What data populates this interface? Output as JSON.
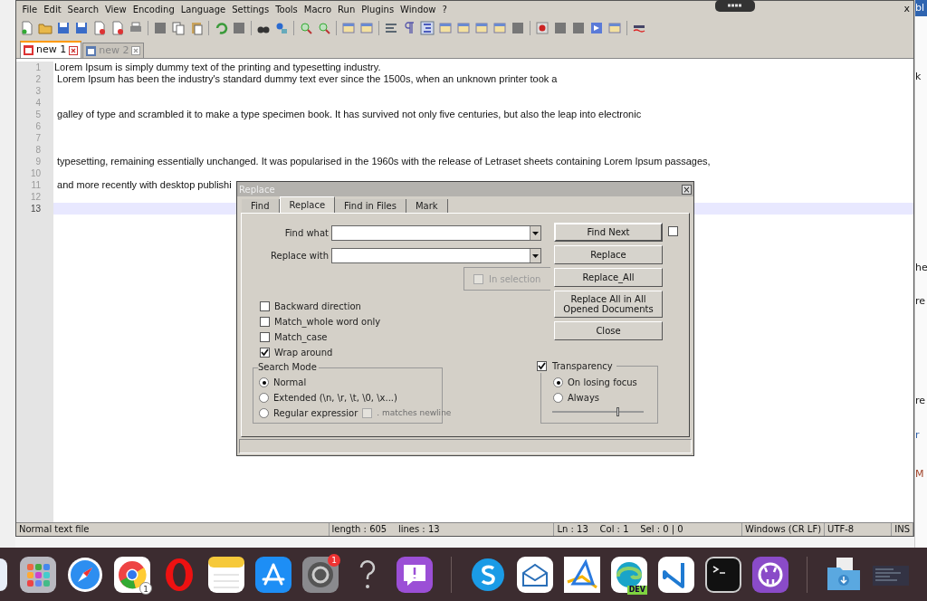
{
  "menu": [
    "File",
    "Edit",
    "Search",
    "View",
    "Encoding",
    "Language",
    "Settings",
    "Tools",
    "Macro",
    "Run",
    "Plugins",
    "Window",
    "?"
  ],
  "window_close": "x",
  "tabs": [
    {
      "label": "new 1",
      "selected": true
    },
    {
      "label": "new 2",
      "selected": false
    }
  ],
  "editor": {
    "lines": [
      {
        "number": "1",
        "text": "Lorem Ipsum is simply dummy text of the printing and typesetting industry.",
        "current": false
      },
      {
        "number": "2",
        "text": " Lorem Ipsum has been the industry's standard dummy text ever since the 1500s, when an unknown printer took a",
        "current": false
      },
      {
        "number": "3",
        "current": false
      },
      {
        "number": "4",
        "current": false
      },
      {
        "number": "5",
        "text": " galley of type and scrambled it to make a type specimen book. It has survived not only five centuries, but also the leap into electronic",
        "current": false
      },
      {
        "number": "6",
        "current": false
      },
      {
        "number": "7",
        "current": false
      },
      {
        "number": "8",
        "current": false
      },
      {
        "number": "9",
        "text": " typesetting, remaining essentially unchanged. It was popularised in the 1960s with the release of Letraset sheets containing Lorem Ipsum passages,",
        "current": false
      },
      {
        "number": "10",
        "current": false
      },
      {
        "number": "11",
        "text": " and more recently with desktop publishi",
        "current": false
      },
      {
        "number": "12",
        "current": false
      },
      {
        "number": "13",
        "current": true
      }
    ]
  },
  "status_bar": [
    "Normal text file",
    "length : 605    lines : 13",
    "Ln : 13    Col : 1    Sel : 0 | 0",
    "Windows (CR LF)",
    "UTF-8",
    "INS"
  ],
  "dialog": {
    "title": "Replace",
    "close": "×",
    "tabs": [
      {
        "label": "Find",
        "selected": false
      },
      {
        "label": "Replace",
        "selected": true
      },
      {
        "label": "Find in Files",
        "selected": false
      },
      {
        "label": "Mark",
        "selected": false
      }
    ],
    "find_what": {
      "label": "Find what"
    },
    "replace_with": {
      "label": "Replace with"
    },
    "find_next_checkbox": {
      "checked": false
    },
    "in_selection": {
      "label": "In selection",
      "checked": false,
      "disabled": true
    },
    "buttons": [
      "Find Next",
      "Replace",
      "Replace_All",
      "Replace All in All\nOpened Documents",
      "Close"
    ],
    "options": [
      {
        "label": "Backward direction",
        "checked": false
      },
      {
        "label": "Match_whole word only",
        "checked": false
      },
      {
        "label": "Match_case",
        "checked": false
      },
      {
        "label": "Wrap around",
        "checked": true
      }
    ],
    "search_mode": {
      "title": "Search Mode",
      "modes": [
        {
          "label": "Normal",
          "selected": true
        },
        {
          "label": "Extended (\\n, \\r, \\t, \\0, \\x...)",
          "selected": false
        },
        {
          "label": "Regular expressior",
          "selected": false
        }
      ],
      "matches_newline": {
        "label": ". matches newline",
        "checked": false,
        "disabled": true
      }
    },
    "transparency": {
      "label": "Transparency",
      "checked": true,
      "modes": [
        {
          "label": "On losing focus",
          "selected": true
        },
        {
          "label": "Always",
          "selected": false
        }
      ],
      "level": 0.72
    }
  },
  "background_page": [
    {
      "text": "bl",
      "kind": "header"
    },
    {
      "text": "k",
      "kind": "text"
    },
    {
      "text": "he",
      "kind": "text"
    },
    {
      "text": "re",
      "kind": "text"
    },
    {
      "text": "re",
      "kind": "text"
    },
    {
      "text": "r",
      "kind": "link"
    },
    {
      "text": "M",
      "kind": "warning"
    }
  ],
  "dock": [
    {
      "kind": "finder"
    },
    {
      "kind": "launchpad"
    },
    {
      "kind": "safari"
    },
    {
      "kind": "chrome",
      "badge": "1"
    },
    {
      "kind": "opera"
    },
    {
      "kind": "notes"
    },
    {
      "kind": "appstore"
    },
    {
      "kind": "settings",
      "badge": "1"
    },
    {
      "kind": "help"
    },
    {
      "kind": "feedback"
    },
    {
      "kind": "separator"
    },
    {
      "kind": "skype"
    },
    {
      "kind": "mail"
    },
    {
      "kind": "zeplin"
    },
    {
      "kind": "edge",
      "label": "DEV"
    },
    {
      "kind": "vscode"
    },
    {
      "kind": "terminal"
    },
    {
      "kind": "github"
    },
    {
      "kind": "separator"
    },
    {
      "kind": "downloads"
    },
    {
      "kind": "screenshot"
    }
  ]
}
